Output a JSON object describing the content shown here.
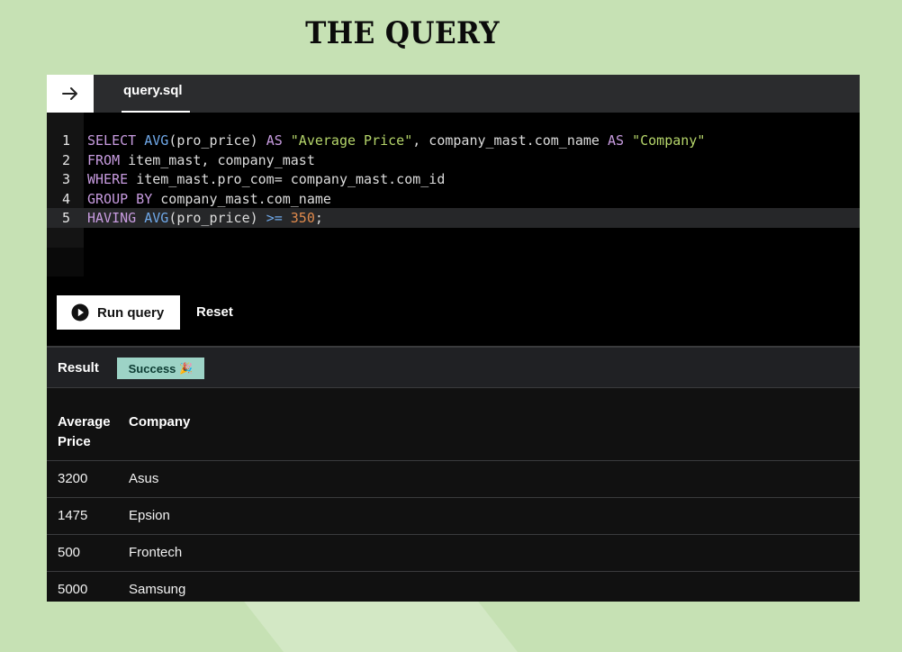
{
  "page": {
    "title": "THE QUERY"
  },
  "editor": {
    "tab_label": "query.sql",
    "arrow_icon": "arrow-right-icon",
    "lines": [
      {
        "num": "1",
        "tokens": [
          {
            "t": "SELECT ",
            "c": "kw"
          },
          {
            "t": "AVG",
            "c": "fn"
          },
          {
            "t": "(pro_price) ",
            "c": ""
          },
          {
            "t": "AS ",
            "c": "kw"
          },
          {
            "t": "\"Average Price\"",
            "c": "str"
          },
          {
            "t": ", company_mast.com_name ",
            "c": ""
          },
          {
            "t": "AS ",
            "c": "kw"
          },
          {
            "t": "\"Company\"",
            "c": "str"
          }
        ]
      },
      {
        "num": "2",
        "tokens": [
          {
            "t": "FROM ",
            "c": "kw"
          },
          {
            "t": "item_mast, company_mast",
            "c": ""
          }
        ]
      },
      {
        "num": "3",
        "tokens": [
          {
            "t": "WHERE ",
            "c": "kw"
          },
          {
            "t": "item_mast.pro_com= company_mast.com_id",
            "c": ""
          }
        ]
      },
      {
        "num": "4",
        "tokens": [
          {
            "t": "GROUP BY ",
            "c": "kw"
          },
          {
            "t": "company_mast.com_name",
            "c": ""
          }
        ]
      },
      {
        "num": "5",
        "tokens": [
          {
            "t": "HAVING ",
            "c": "kw"
          },
          {
            "t": "AVG",
            "c": "fn"
          },
          {
            "t": "(pro_price) ",
            "c": ""
          },
          {
            "t": ">= ",
            "c": "fn"
          },
          {
            "t": "350",
            "c": "numlit"
          },
          {
            "t": ";",
            "c": ""
          }
        ]
      }
    ]
  },
  "controls": {
    "run_label": "Run query",
    "run_icon": "play-circle-icon",
    "reset_label": "Reset"
  },
  "result": {
    "label": "Result",
    "badge_text": "Success",
    "badge_emoji": "🎉",
    "colors": {
      "badge_bg": "#9dd3c6"
    },
    "headers": [
      [
        "Average",
        "Price"
      ],
      [
        "Company"
      ]
    ],
    "rows": [
      [
        "3200",
        "Asus"
      ],
      [
        "1475",
        "Epsion"
      ],
      [
        "500",
        "Frontech"
      ],
      [
        "5000",
        "Samsung"
      ]
    ]
  }
}
